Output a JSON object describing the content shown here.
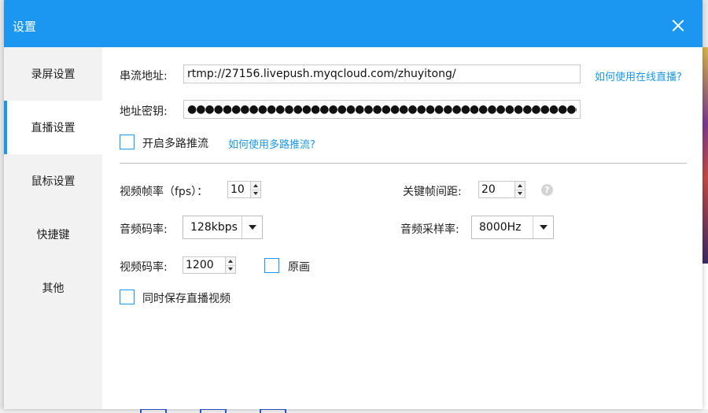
{
  "window": {
    "title": "设置"
  },
  "sidebar": {
    "items": [
      {
        "label": "录屏设置"
      },
      {
        "label": "直播设置"
      },
      {
        "label": "鼠标设置"
      },
      {
        "label": "快捷键"
      },
      {
        "label": "其他"
      }
    ],
    "active": "直播设置"
  },
  "stream": {
    "url_label": "串流地址:",
    "url_value": "rtmp://27156.livepush.myqcloud.com/zhuyitong/",
    "url_help_link": "如何使用在线直播?",
    "key_label": "地址密钥:",
    "key_value": "●●●●●●●●●●●●●●●●●●●●●●●●●●●●●●●●●●●●●●●●●●●●●●●●●●●●",
    "multi_push_label": "开启多路推流",
    "multi_push_checked": false,
    "multi_push_help_link": "如何使用多路推流?"
  },
  "video": {
    "fps_label": "视频帧率（fps）：",
    "fps_value": "10",
    "keyframe_label": "关键帧间距:",
    "keyframe_value": "20",
    "help_icon": "?",
    "audio_bitrate_label": "音频码率:",
    "audio_bitrate_value": "128kbps",
    "audio_samplerate_label": "音频采样率:",
    "audio_samplerate_value": "8000Hz",
    "video_bitrate_label": "视频码率:",
    "video_bitrate_value": "1200",
    "original_label": "原画",
    "original_checked": false,
    "save_video_label": "同时保存直播视频",
    "save_video_checked": false
  },
  "colors": {
    "accent": "#1b97f1",
    "sidebar_bg": "#f2f2f2",
    "link": "#1b97f1"
  }
}
